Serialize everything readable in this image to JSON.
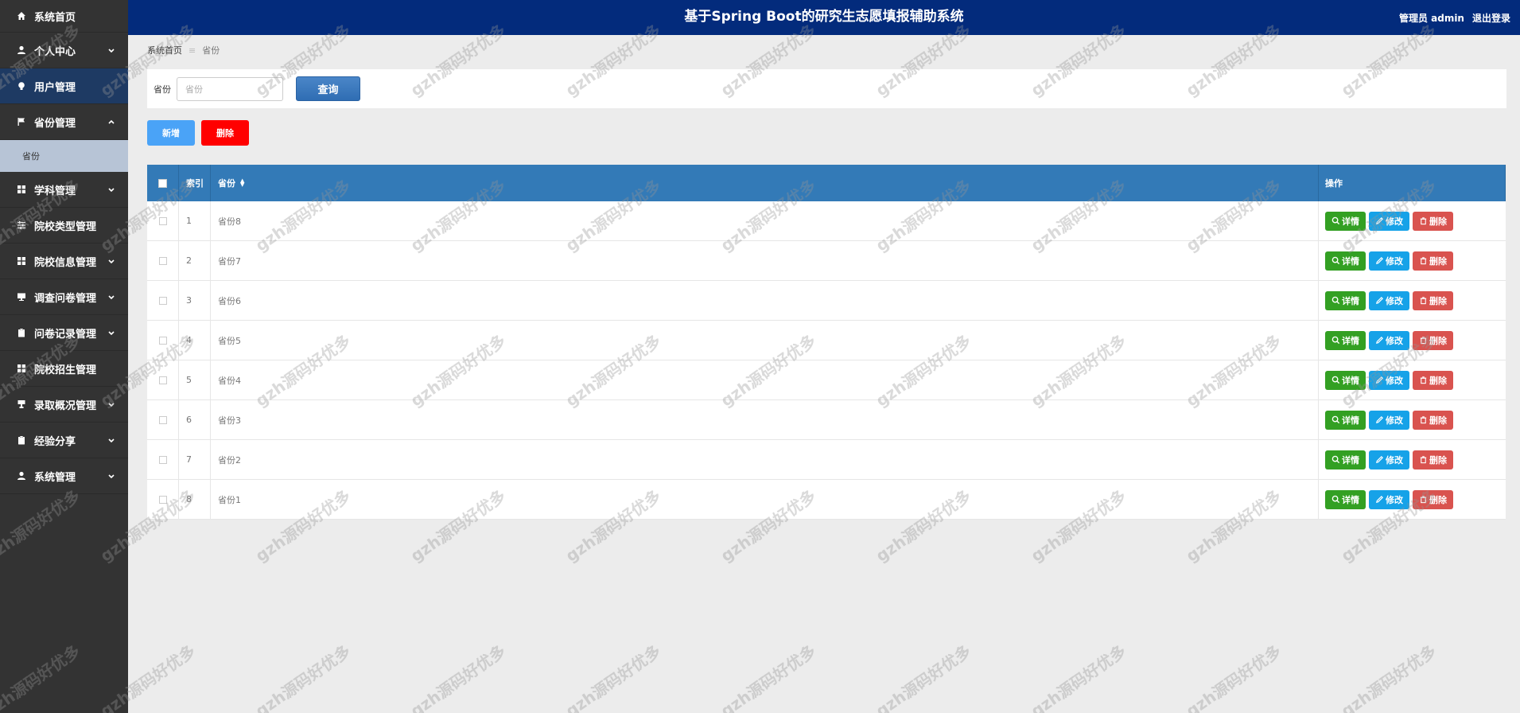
{
  "header": {
    "title": "基于Spring Boot的研究生志愿填报辅助系统",
    "user_label": "管理员 admin",
    "logout_label": "退出登录"
  },
  "sidebar": {
    "items": [
      {
        "label": "系统首页",
        "icon": "home-icon",
        "chevron": false
      },
      {
        "label": "个人中心",
        "icon": "user-icon",
        "chevron": true
      },
      {
        "label": "用户管理",
        "icon": "bulb-icon",
        "chevron": false
      },
      {
        "label": "省份管理",
        "icon": "flag-icon",
        "chevron": true
      },
      {
        "label": "学科管理",
        "icon": "grid-icon",
        "chevron": true
      },
      {
        "label": "院校类型管理",
        "icon": "sliders-icon",
        "chevron": false
      },
      {
        "label": "院校信息管理",
        "icon": "grid-icon",
        "chevron": true
      },
      {
        "label": "调查问卷管理",
        "icon": "monitor-icon",
        "chevron": true
      },
      {
        "label": "问卷记录管理",
        "icon": "clipboard-icon",
        "chevron": true
      },
      {
        "label": "院校招生管理",
        "icon": "grid-icon",
        "chevron": false
      },
      {
        "label": "录取概况管理",
        "icon": "stamp-icon",
        "chevron": true
      },
      {
        "label": "经验分享",
        "icon": "clipboard-icon",
        "chevron": true
      },
      {
        "label": "系统管理",
        "icon": "user-icon",
        "chevron": true
      }
    ],
    "subitem": "省份"
  },
  "breadcrumb": {
    "home": "系统首页",
    "separator": "≡",
    "current": "省份"
  },
  "search": {
    "label": "省份",
    "placeholder": "省份",
    "button": "查询"
  },
  "actions": {
    "add": "新增",
    "delete": "删除"
  },
  "table": {
    "headers": {
      "index": "索引",
      "province": "省份",
      "ops": "操作"
    },
    "rows": [
      {
        "index": "1",
        "province": "省份8"
      },
      {
        "index": "2",
        "province": "省份7"
      },
      {
        "index": "3",
        "province": "省份6"
      },
      {
        "index": "4",
        "province": "省份5"
      },
      {
        "index": "5",
        "province": "省份4"
      },
      {
        "index": "6",
        "province": "省份3"
      },
      {
        "index": "7",
        "province": "省份2"
      },
      {
        "index": "8",
        "province": "省份1"
      }
    ],
    "op_labels": {
      "detail": "详情",
      "edit": "修改",
      "delete": "删除"
    }
  },
  "watermark": "gzh源码好优多",
  "colors": {
    "header_bg": "#032b7c",
    "sidebar_bg": "#333333",
    "table_header_bg": "#337ab7",
    "detail_btn": "#33a023",
    "edit_btn": "#16a2e8",
    "delete_btn": "#d9534f",
    "delete_action": "#ff0000",
    "add_action": "#4aa3f7"
  }
}
